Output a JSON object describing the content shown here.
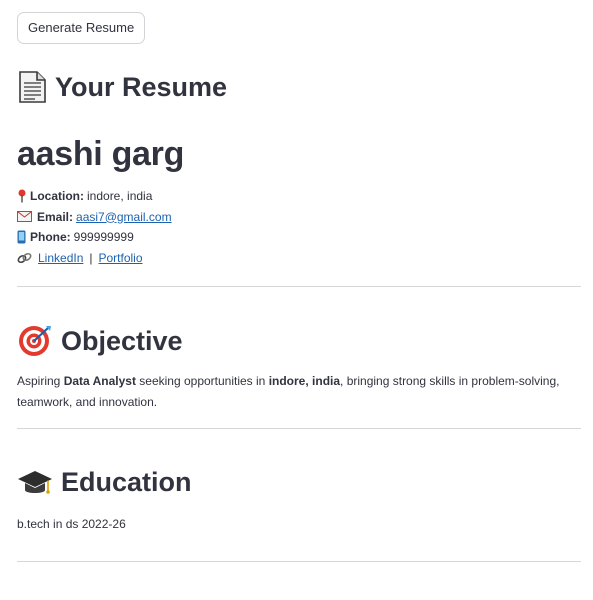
{
  "generate_button": "Generate Resume",
  "page_title": "Your Resume",
  "name": "aashi garg",
  "contact": {
    "location_label": "Location:",
    "location_value": "indore, india",
    "email_label": "Email:",
    "email_value": "aasi7@gmail.com",
    "phone_label": "Phone:",
    "phone_value": "999999999",
    "linkedin": "LinkedIn",
    "separator": "|",
    "portfolio": "Portfolio"
  },
  "objective": {
    "heading": "Objective",
    "text_1": "Aspiring ",
    "text_bold_1": "Data Analyst",
    "text_2": " seeking opportunities in ",
    "text_bold_2": "indore, india",
    "text_3": ", bringing strong skills in problem-solving, teamwork, and innovation."
  },
  "education": {
    "heading": "Education",
    "text": "b.tech in ds 2022-26"
  },
  "colors": {
    "link": "#1c62b0",
    "text": "#31333f",
    "divider": "#d6d6d9"
  },
  "icons": [
    "document-icon",
    "pin-icon",
    "envelope-icon",
    "phone-icon",
    "link-icon",
    "target-icon",
    "graduation-cap-icon"
  ]
}
